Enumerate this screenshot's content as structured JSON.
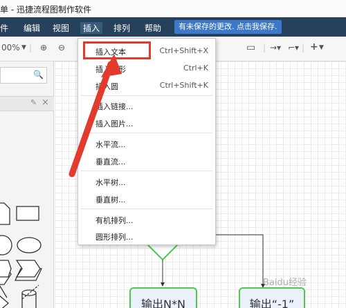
{
  "app": {
    "title": "单 - 迅捷流程图制作软件"
  },
  "menubar": {
    "items": [
      "件",
      "编辑",
      "视图",
      "插入",
      "排列",
      "帮助"
    ],
    "save_notice": "有未保存的更改. 点击我保存."
  },
  "toolbar": {
    "zoom": "00%"
  },
  "dropdown": {
    "items": [
      {
        "label": "插入文本",
        "shortcut": "Ctrl+Shift+X"
      },
      {
        "label": "插入矩形",
        "shortcut": "Ctrl+K"
      },
      {
        "label": "插入圆",
        "shortcut": "Ctrl+Shift+K"
      },
      {
        "label": "插入链接...",
        "shortcut": ""
      },
      {
        "label": "插入图片...",
        "shortcut": ""
      },
      {
        "label": "水平流...",
        "shortcut": ""
      },
      {
        "label": "垂直流...",
        "shortcut": ""
      },
      {
        "label": "水平树...",
        "shortcut": ""
      },
      {
        "label": "垂直树...",
        "shortcut": ""
      },
      {
        "label": "有机排列...",
        "shortcut": ""
      },
      {
        "label": "圆形排列...",
        "shortcut": ""
      }
    ]
  },
  "canvas": {
    "node_left": "输出N*N",
    "node_right": "输出“-1”"
  },
  "watermark": "Baidu经验",
  "colors": {
    "menubar": "#27415c",
    "accent": "#3c79c8",
    "highlight": "#e23b2e",
    "node_border": "#4cc94c"
  }
}
